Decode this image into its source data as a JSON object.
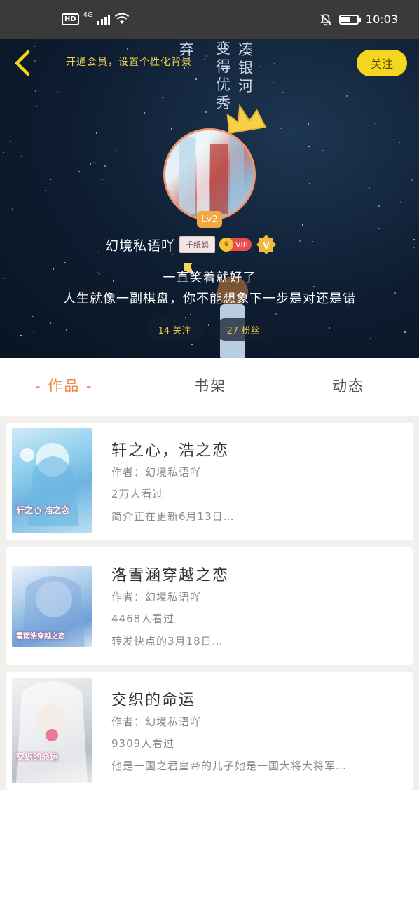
{
  "status_bar": {
    "hd": "HD",
    "network": "4G",
    "time": "10:03",
    "battery_level": 0.55
  },
  "header": {
    "banner_text": "开通会员，设置个性化背景",
    "follow_label": "关注",
    "poem_chars_1": [
      "弃"
    ],
    "poem_chars_2": [
      "变",
      "得",
      "优",
      "秀"
    ],
    "poem_chars_3": [
      "凑",
      "银",
      "河"
    ]
  },
  "profile": {
    "level": "Lv2",
    "username": "幻境私语吖",
    "crane_badge": "千纸鹤",
    "vip_label": "VIP",
    "v_label": "V",
    "signature_line1": "一直笑着就好了",
    "signature_line2": "人生就像一副棋盘，你不能想象下一步是对还是错",
    "following": "14 关注",
    "fans": "27 粉丝"
  },
  "tabs": [
    {
      "label": "- 作品 -",
      "active": true
    },
    {
      "label": "书架",
      "active": false
    },
    {
      "label": "动态",
      "active": false
    }
  ],
  "books": [
    {
      "title": "轩之心，浩之恋",
      "author": "作者：幻境私语吖",
      "views": "2万人看过",
      "intro": "简介正在更新6月13日…",
      "cover_text": "轩之心 浩之恋"
    },
    {
      "title": "洛雪涵穿越之恋",
      "author": "作者：幻境私语吖",
      "views": "4468人看过",
      "intro": "转发快点的3月18日…",
      "cover_text": "霍雨浩穿越之恋"
    },
    {
      "title": "交织的命运",
      "author": "作者：幻境私语吖",
      "views": "9309人看过",
      "intro": "他是一国之君皇帝的儿子她是一国大将大将军…",
      "cover_text": "交织的命运"
    }
  ],
  "colors": {
    "accent": "#f08a4b",
    "follow_button": "#f5d61e",
    "banner_text": "#f4d34a"
  }
}
